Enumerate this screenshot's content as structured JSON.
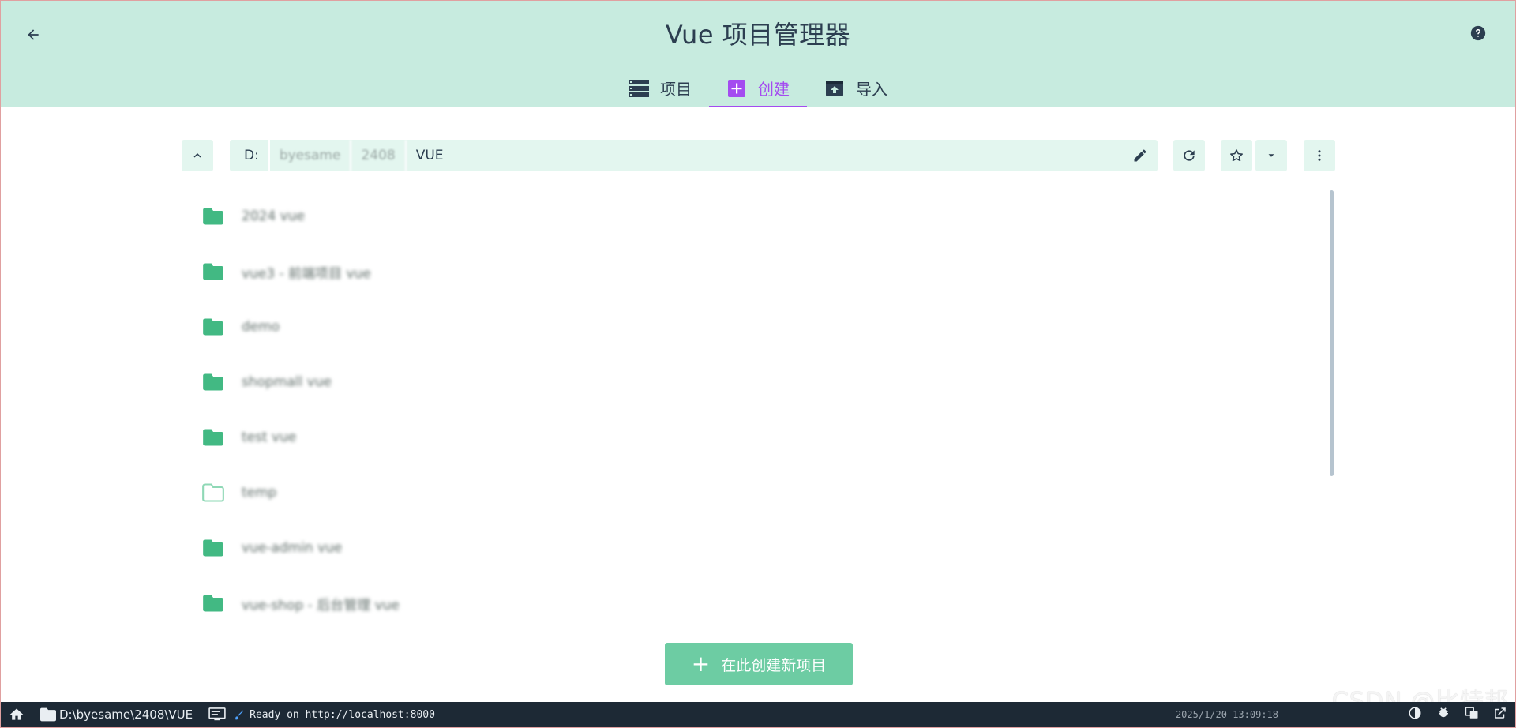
{
  "app": {
    "title": "Vue 项目管理器"
  },
  "tabs": [
    {
      "label": "项目",
      "icon": "list-icon",
      "active": false
    },
    {
      "label": "创建",
      "icon": "add-box-icon",
      "active": true
    },
    {
      "label": "导入",
      "icon": "import-icon",
      "active": false
    }
  ],
  "pathbar": {
    "segments": [
      "D:",
      "byesame",
      "2408",
      "VUE"
    ],
    "edit_icon": "pencil-icon",
    "refresh_icon": "refresh-icon",
    "favorite_icon": "star-outline-icon",
    "favorites_dropdown_icon": "caret-down-icon",
    "more_icon": "more-vert-icon",
    "up_icon": "chevron-up-icon"
  },
  "folders": [
    {
      "name": "2024 vue",
      "type": "filled"
    },
    {
      "name": "vue3 - 前端项目 vue",
      "type": "filled"
    },
    {
      "name": "demo",
      "type": "filled"
    },
    {
      "name": "shopmall vue",
      "type": "filled"
    },
    {
      "name": "test vue",
      "type": "filled"
    },
    {
      "name": "temp",
      "type": "outline"
    },
    {
      "name": "vue-admin vue",
      "type": "filled"
    },
    {
      "name": "vue-shop - 后台管理 vue",
      "type": "filled"
    }
  ],
  "create_button": {
    "label": "在此创建新项目"
  },
  "statusbar": {
    "path": "D:\\byesame\\2408\\VUE",
    "log": "Ready on http://localhost:8000",
    "time": "2025/1/20 13:09:18",
    "watermark": "CSDN @比特邦"
  },
  "colors": {
    "header_bg": "#c7ebdf",
    "accent": "#a44cf0",
    "primary_green": "#42b983",
    "statusbar_bg": "#1d2935"
  }
}
